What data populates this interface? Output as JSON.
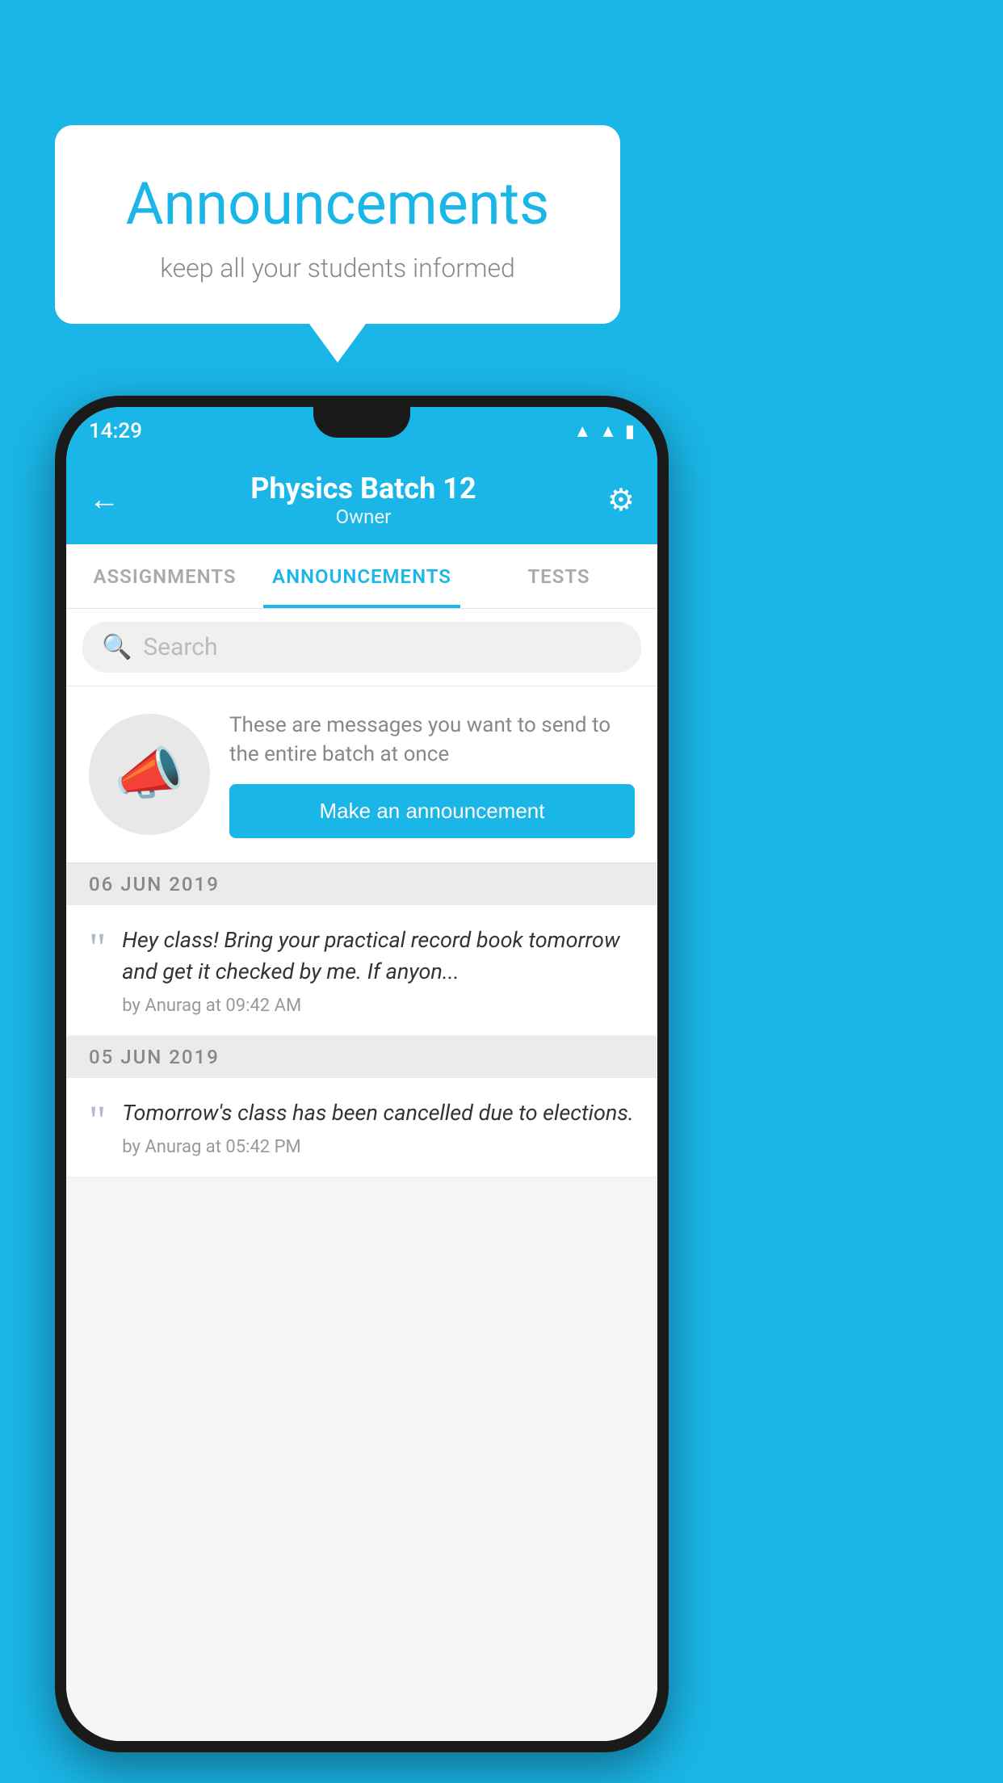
{
  "background_color": "#1ab6e8",
  "speech_bubble": {
    "title": "Announcements",
    "subtitle": "keep all your students informed"
  },
  "phone": {
    "status_bar": {
      "time": "14:29",
      "icons": [
        "wifi",
        "signal",
        "battery"
      ]
    },
    "header": {
      "back_label": "←",
      "title": "Physics Batch 12",
      "subtitle": "Owner",
      "gear_label": "⚙"
    },
    "tabs": [
      {
        "label": "ASSIGNMENTS",
        "active": false
      },
      {
        "label": "ANNOUNCEMENTS",
        "active": true
      },
      {
        "label": "TESTS",
        "active": false
      }
    ],
    "search": {
      "placeholder": "Search"
    },
    "promo": {
      "description": "These are messages you want to send to the entire batch at once",
      "button_label": "Make an announcement"
    },
    "announcements": [
      {
        "date": "06  JUN  2019",
        "text": "Hey class! Bring your practical record book tomorrow and get it checked by me. If anyon...",
        "meta": "by Anurag at 09:42 AM"
      },
      {
        "date": "05  JUN  2019",
        "text": "Tomorrow's class has been cancelled due to elections.",
        "meta": "by Anurag at 05:42 PM"
      }
    ]
  }
}
